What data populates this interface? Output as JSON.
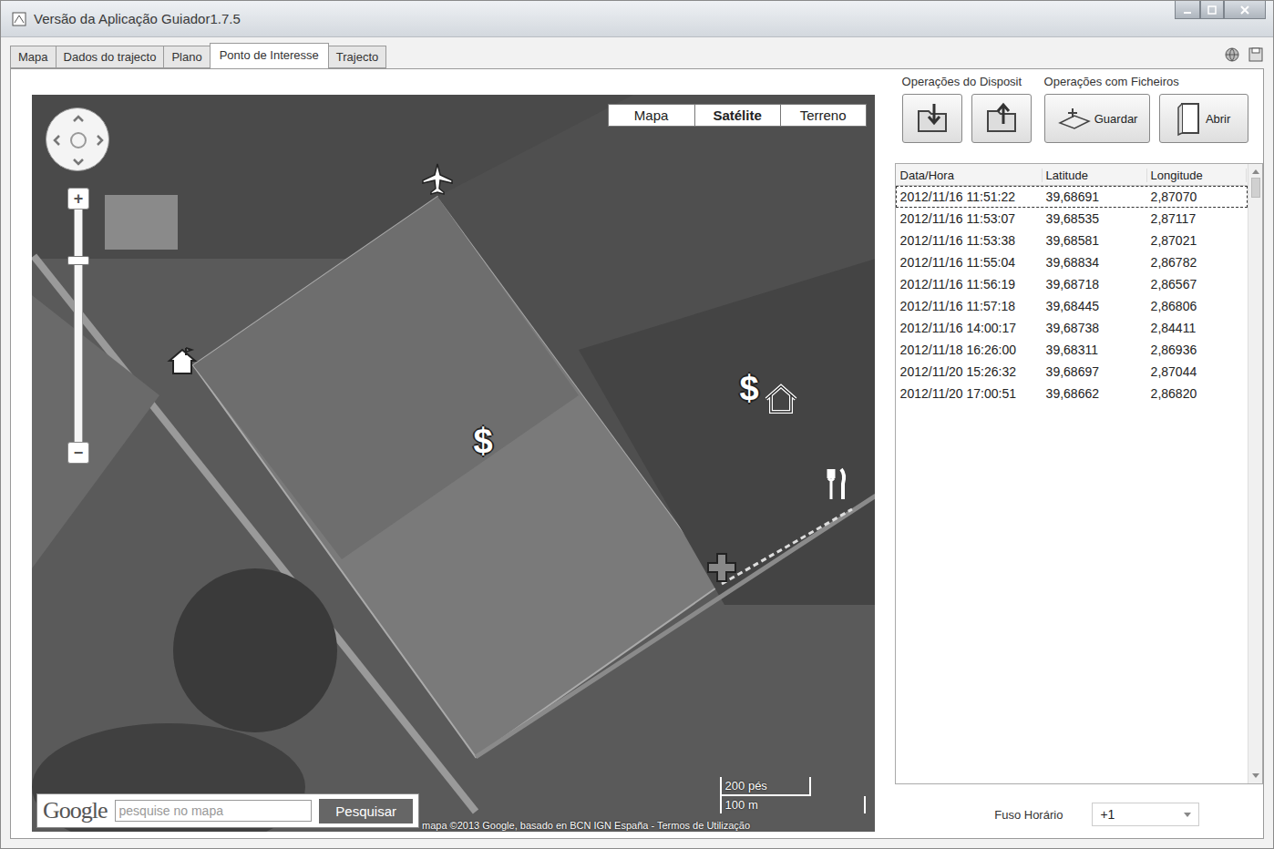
{
  "window": {
    "title": "Versão da Aplicação Guiador1.7.5"
  },
  "tabs": [
    {
      "label": "Mapa",
      "selected": false
    },
    {
      "label": "Dados do trajecto",
      "selected": false
    },
    {
      "label": "Plano",
      "selected": false
    },
    {
      "label": "Ponto de Interesse",
      "selected": true
    },
    {
      "label": "Trajecto",
      "selected": false
    }
  ],
  "map": {
    "type_buttons": [
      {
        "label": "Mapa",
        "selected": false
      },
      {
        "label": "Satélite",
        "selected": true
      },
      {
        "label": "Terreno",
        "selected": false
      }
    ],
    "zoom": {
      "level": 0.78,
      "zoom_in": "+",
      "zoom_out": "−"
    },
    "pins": [
      {
        "kind": "airport"
      },
      {
        "kind": "home"
      },
      {
        "kind": "money",
        "label": "$"
      },
      {
        "kind": "money",
        "label": "$"
      },
      {
        "kind": "house"
      },
      {
        "kind": "restaurant"
      },
      {
        "kind": "hospital"
      }
    ],
    "scale": {
      "imperial": "200 pés",
      "metric": "100 m"
    },
    "search": {
      "logo": "Google",
      "placeholder": "pesquise no mapa",
      "button": "Pesquisar"
    },
    "copyright": "mapa ©2013 Google, basado en BCN IGN España - Termos de Utilização"
  },
  "device_ops": {
    "title": "Operações do Disposit",
    "buttons": [
      {
        "kind": "download"
      },
      {
        "kind": "upload"
      }
    ]
  },
  "file_ops": {
    "title": "Operações com Ficheiros",
    "buttons": [
      {
        "label": "Guardar",
        "kind": "save"
      },
      {
        "label": "Abrir",
        "kind": "open"
      }
    ]
  },
  "table": {
    "columns": [
      "Data/Hora",
      "Latitude",
      "Longitude"
    ],
    "rows": [
      {
        "cells": [
          "2012/11/16 11:51:22",
          "39,68691",
          "2,87070"
        ],
        "selected": true
      },
      {
        "cells": [
          "2012/11/16 11:53:07",
          "39,68535",
          "2,87117"
        ],
        "selected": false
      },
      {
        "cells": [
          "2012/11/16 11:53:38",
          "39,68581",
          "2,87021"
        ],
        "selected": false
      },
      {
        "cells": [
          "2012/11/16 11:55:04",
          "39,68834",
          "2,86782"
        ],
        "selected": false
      },
      {
        "cells": [
          "2012/11/16 11:56:19",
          "39,68718",
          "2,86567"
        ],
        "selected": false
      },
      {
        "cells": [
          "2012/11/16 11:57:18",
          "39,68445",
          "2,86806"
        ],
        "selected": false
      },
      {
        "cells": [
          "2012/11/16 14:00:17",
          "39,68738",
          "2,84411"
        ],
        "selected": false
      },
      {
        "cells": [
          "2012/11/18 16:26:00",
          "39,68311",
          "2,86936"
        ],
        "selected": false
      },
      {
        "cells": [
          "2012/11/20 15:26:32",
          "39,68697",
          "2,87044"
        ],
        "selected": false
      },
      {
        "cells": [
          "2012/11/20 17:00:51",
          "39,68662",
          "2,86820"
        ],
        "selected": false
      }
    ]
  },
  "timezone": {
    "label": "Fuso Horário",
    "value": "+1"
  }
}
